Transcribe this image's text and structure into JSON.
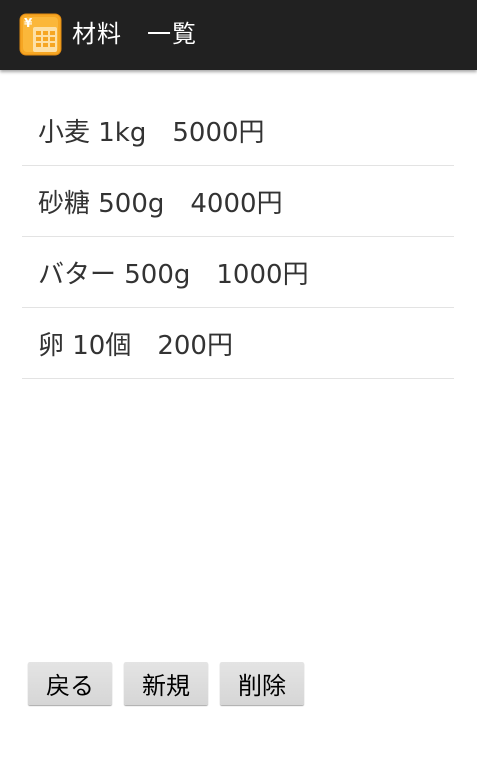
{
  "action_bar": {
    "title": "材料　一覧",
    "icon": "calculator-yen-icon",
    "background": "#212121"
  },
  "materials": [
    {
      "label": "小麦 1kg　5000円"
    },
    {
      "label": "砂糖 500g　4000円"
    },
    {
      "label": "バター 500g　1000円"
    },
    {
      "label": "卵 10個　200円"
    }
  ],
  "buttons": {
    "back_label": "戻る",
    "new_label": "新規",
    "delete_label": "削除"
  }
}
